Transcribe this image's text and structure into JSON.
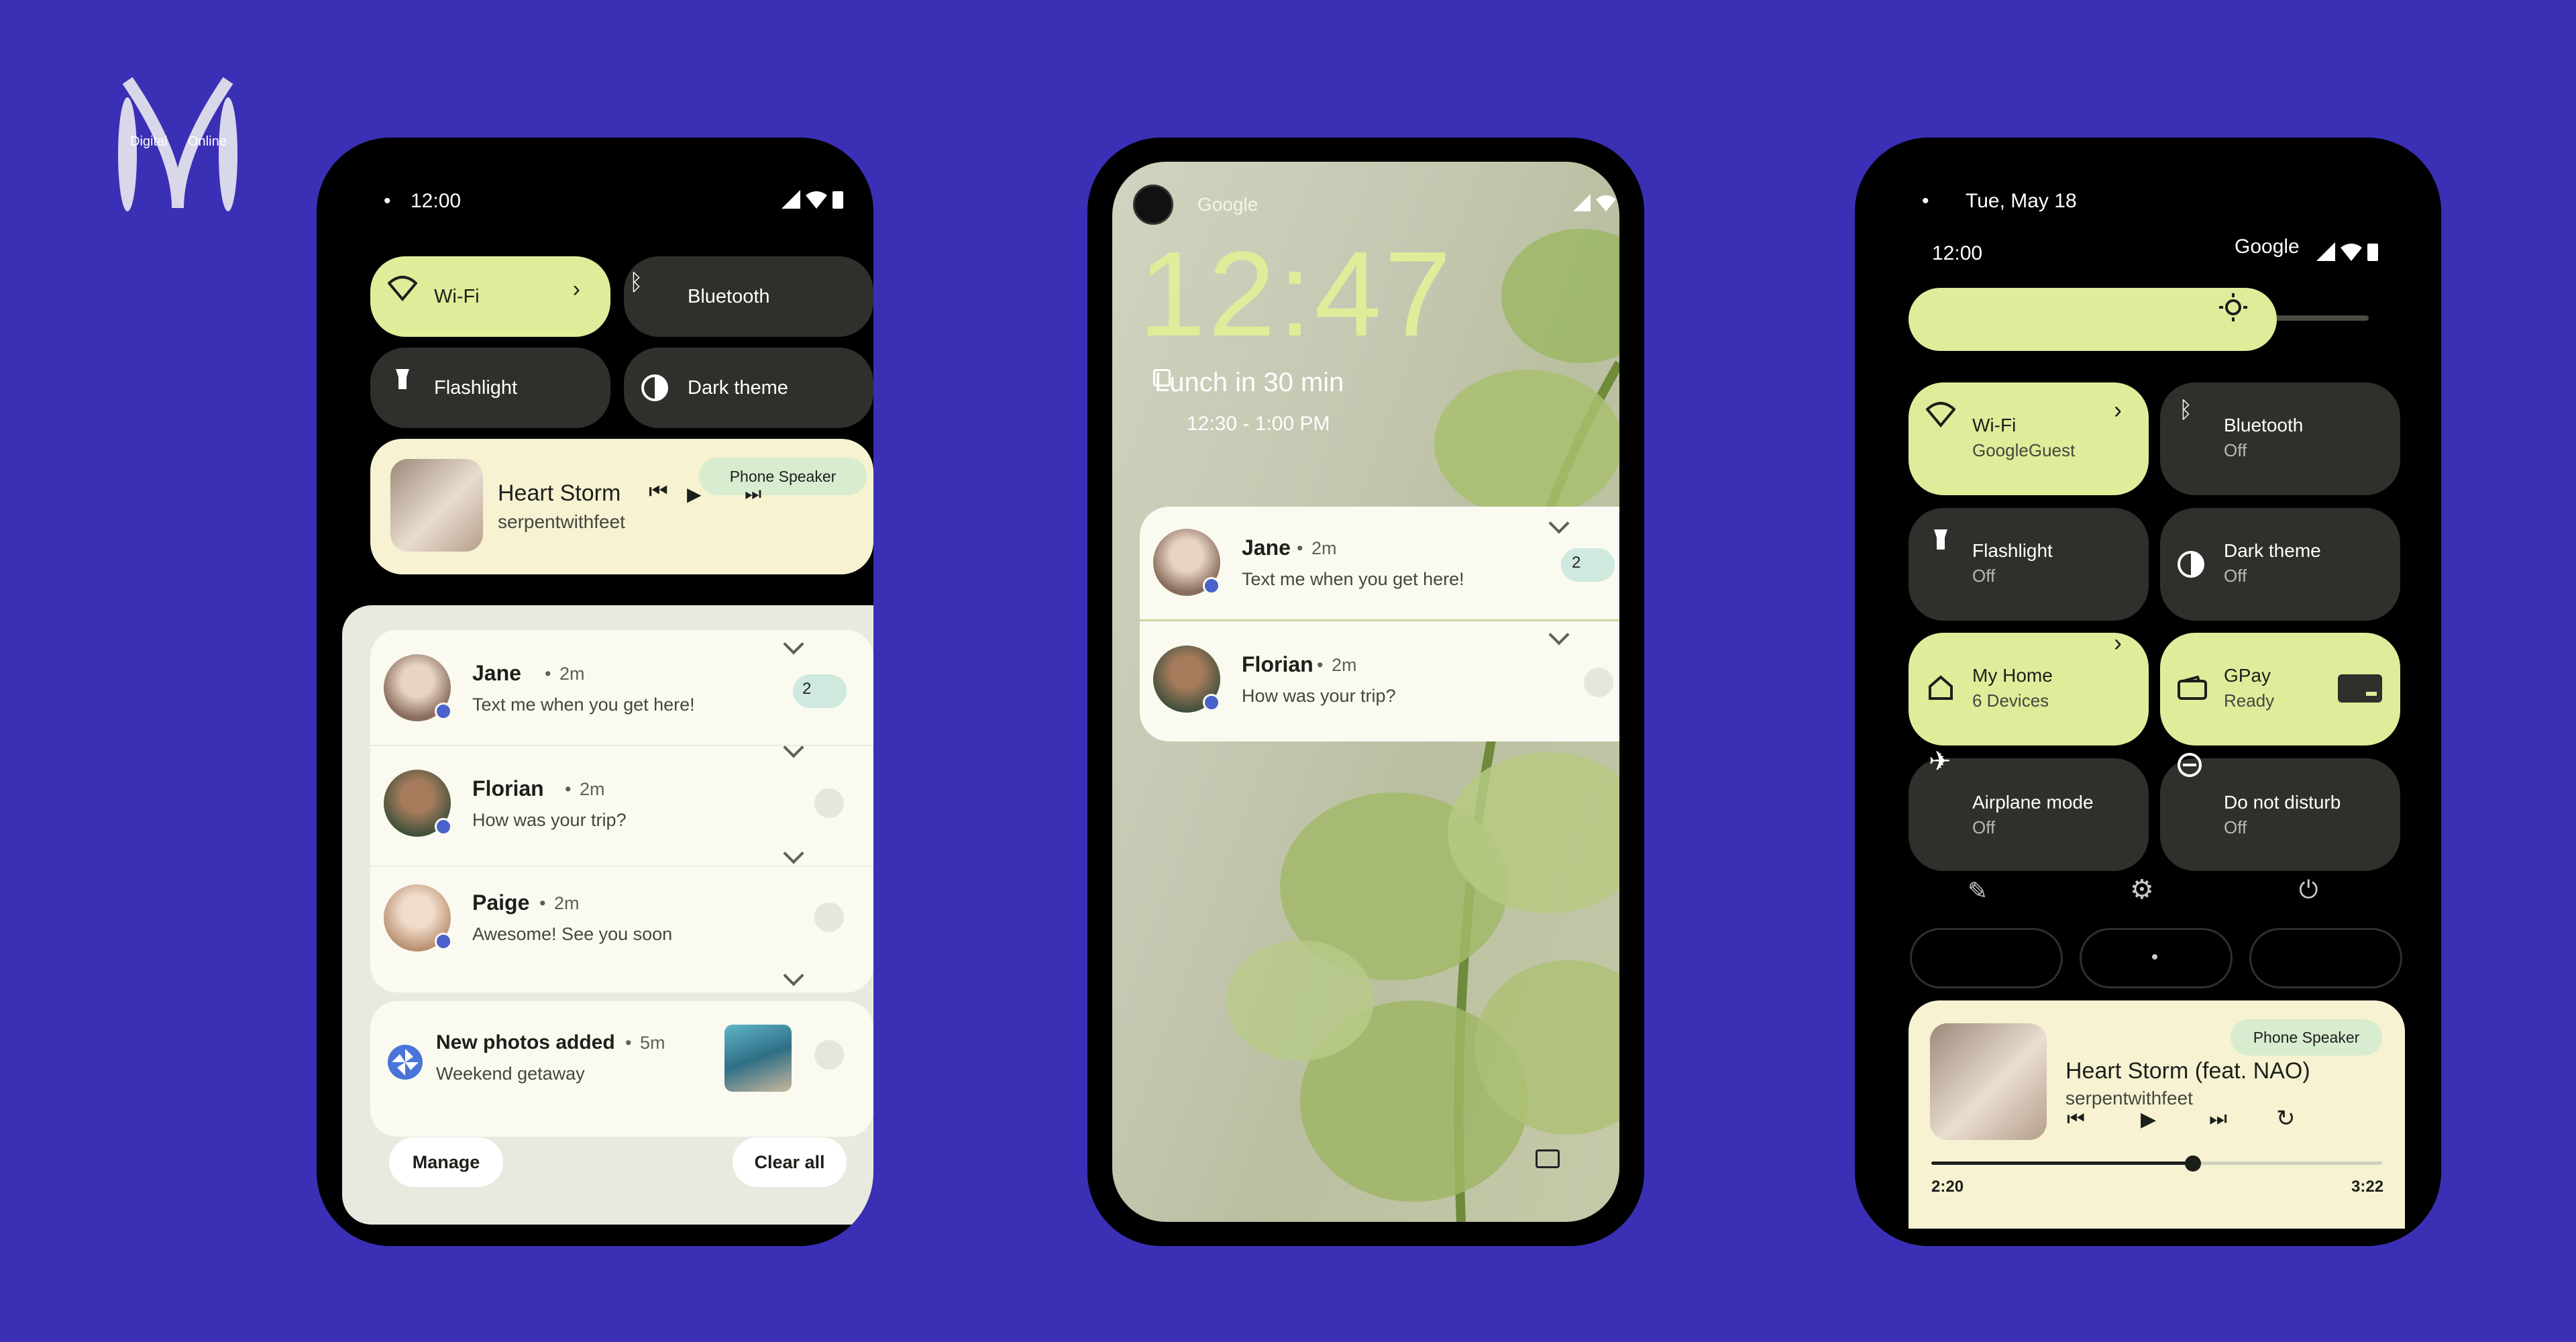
{
  "brand": {
    "logo_left": "Digital",
    "logo_right": "Online"
  },
  "phone1": {
    "time": "12:00",
    "tiles": [
      {
        "label": "Wi-Fi",
        "state": "on"
      },
      {
        "label": "Bluetooth",
        "state": "off"
      },
      {
        "label": "Flashlight",
        "state": "off"
      },
      {
        "label": "Dark theme",
        "state": "off"
      }
    ],
    "media": {
      "title": "Heart Storm",
      "artist": "serpentwithfeet",
      "output": "Phone Speaker"
    },
    "notifications": [
      {
        "name": "Jane",
        "time": "2m",
        "text": "Text me when you get here!",
        "count": "2"
      },
      {
        "name": "Florian",
        "time": "2m",
        "text": "How was your trip?"
      },
      {
        "name": "Paige",
        "time": "2m",
        "text": "Awesome! See you soon"
      }
    ],
    "photos": {
      "title": "New photos added",
      "time": "5m",
      "text": "Weekend getaway"
    },
    "manage": "Manage",
    "clear_all": "Clear all"
  },
  "phone2": {
    "carrier": "Google",
    "clock": "12:47",
    "event": "Lunch in 30 min",
    "event_time": "12:30 - 1:00 PM",
    "notifications": [
      {
        "name": "Jane",
        "time": "2m",
        "text": "Text me when you get here!",
        "count": "2"
      },
      {
        "name": "Florian",
        "time": "2m",
        "text": "How was your trip?"
      }
    ]
  },
  "phone3": {
    "date": "Tue, May 18",
    "time": "12:00",
    "carrier": "Google",
    "brightness": 0.8,
    "tiles": [
      {
        "label": "Wi-Fi",
        "sub": "GoogleGuest",
        "state": "on"
      },
      {
        "label": "Bluetooth",
        "sub": "Off",
        "state": "off"
      },
      {
        "label": "Flashlight",
        "sub": "Off",
        "state": "off"
      },
      {
        "label": "Dark theme",
        "sub": "Off",
        "state": "off"
      },
      {
        "label": "My Home",
        "sub": "6 Devices",
        "state": "on"
      },
      {
        "label": "GPay",
        "sub": "Ready",
        "state": "on"
      },
      {
        "label": "Airplane mode",
        "sub": "Off",
        "state": "off"
      },
      {
        "label": "Do not disturb",
        "sub": "Off",
        "state": "off"
      }
    ],
    "media": {
      "title": "Heart Storm (feat. NAO)",
      "artist": "serpentwithfeet",
      "output": "Phone Speaker",
      "elapsed": "2:20",
      "total": "3:22",
      "progress": 0.58
    }
  },
  "colors": {
    "background": "#3b2fb5",
    "accent": "#e0ec9a",
    "tile_off": "#2f302b",
    "media_bg": "#f6f2d2"
  }
}
